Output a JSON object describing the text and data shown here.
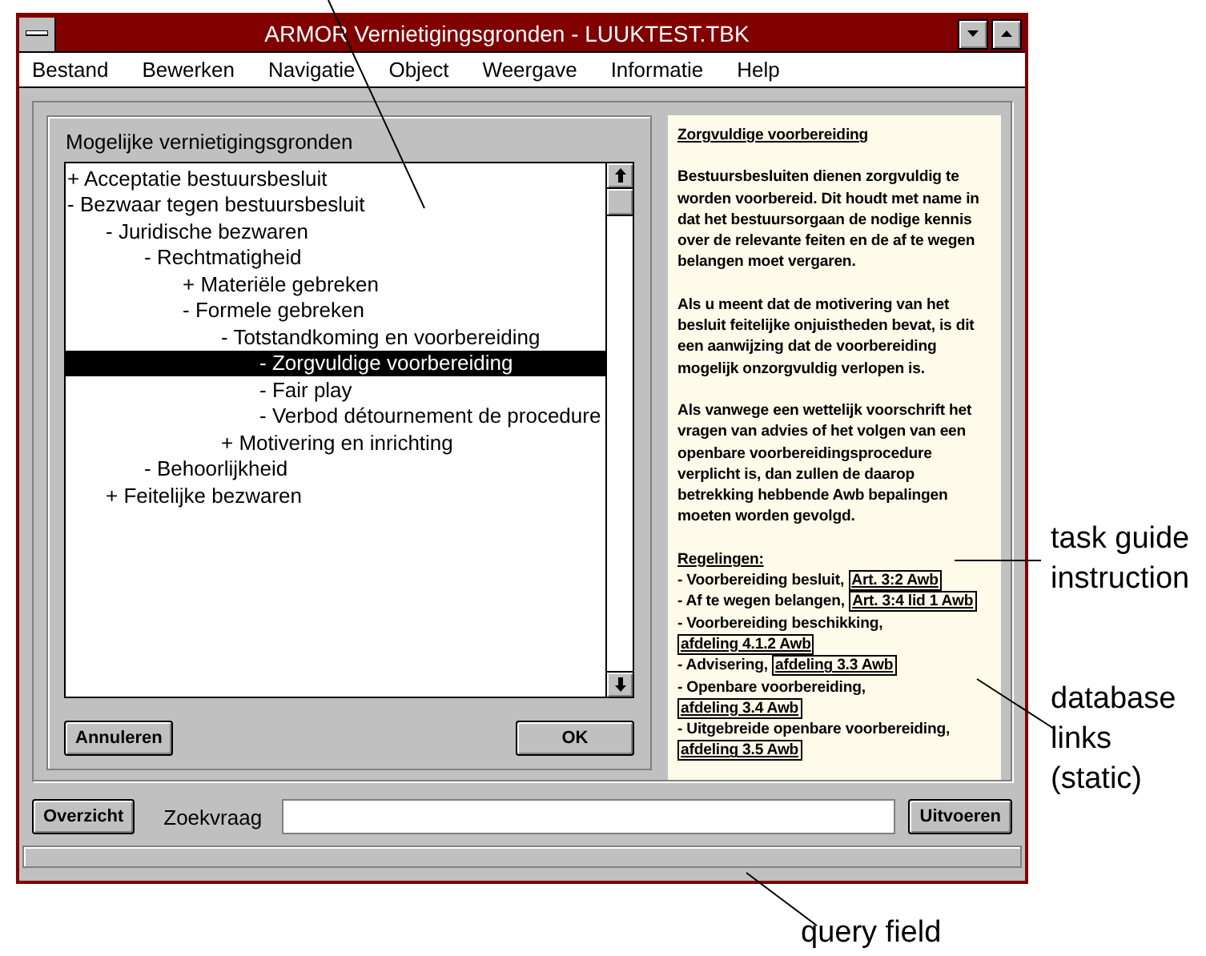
{
  "window": {
    "title": "ARMOR Vernietigingsgronden - LUUKTEST.TBK"
  },
  "menu": [
    "Bestand",
    "Bewerken",
    "Navigatie",
    "Object",
    "Weergave",
    "Informatie",
    "Help"
  ],
  "tree": {
    "title": "Mogelijke vernietigingsgronden",
    "items": [
      {
        "label": "+ Acceptatie bestuursbesluit",
        "selected": false
      },
      {
        "label": "- Bezwaar tegen bestuursbesluit",
        "selected": false,
        "children": [
          {
            "label": "- Juridische bezwaren",
            "selected": false,
            "children": [
              {
                "label": "- Rechtmatigheid",
                "selected": false,
                "children": [
                  {
                    "label": "+ Materiële gebreken",
                    "selected": false
                  },
                  {
                    "label": "- Formele gebreken",
                    "selected": false,
                    "children": [
                      {
                        "label": "- Totstandkoming en voorbereiding",
                        "selected": false,
                        "children": [
                          {
                            "label": "- Zorgvuldige voorbereiding",
                            "selected": true
                          },
                          {
                            "label": "- Fair play",
                            "selected": false
                          },
                          {
                            "label": "- Verbod détournement de procedure",
                            "selected": false
                          }
                        ]
                      },
                      {
                        "label": "+ Motivering en inrichting",
                        "selected": false
                      }
                    ]
                  }
                ]
              },
              {
                "label": "- Behoorlijkheid",
                "selected": false
              }
            ]
          },
          {
            "label": "+ Feitelijke bezwaren",
            "selected": false
          }
        ]
      }
    ],
    "buttons": [
      "Annuleren",
      "OK"
    ]
  },
  "info": {
    "title": "Zorgvuldige voorbereiding",
    "paragraphs": [
      "Bestuursbesluiten dienen zorgvuldig te worden voorbereid. Dit houdt met name in dat het bestuursorgaan de nodige kennis over de relevante feiten en de af te wegen belangen moet vergaren.",
      "Als u meent dat de motivering van het besluit feitelijke onjuistheden bevat, is dit een aanwijzing dat de voorbereiding mogelijk onzorgvuldig verlopen is.",
      "Als vanwege een wettelijk voorschrift het vragen van advies of het volgen van een openbare voorbereidingsprocedure verplicht is, dan zullen de daarop betrekking hebbende Awb bepalingen moeten worden gevolgd."
    ],
    "rules_heading": "Regelingen:",
    "rules": [
      {
        "text": "- Voorbereiding besluit,",
        "link": "Art. 3:2 Awb"
      },
      {
        "text": "- Af te wegen belangen,",
        "link": "Art. 3:4 lid 1 Awb"
      },
      {
        "text": "- Voorbereiding beschikking,",
        "link": "afdeling 4.1.2 Awb"
      },
      {
        "text": "- Advisering,",
        "link": "afdeling 3.3 Awb"
      },
      {
        "text": "- Openbare voorbereiding,",
        "link": "afdeling 3.4 Awb"
      },
      {
        "text": "- Uitgebreide openbare voorbereiding,",
        "link": "afdeling 3.5 Awb"
      }
    ]
  },
  "query": {
    "overview_button": "Overzicht",
    "label": "Zoekvraag",
    "run_button": "Uitvoeren"
  },
  "annotations": [
    "task guide instruction",
    "database links (static)",
    "query field"
  ]
}
